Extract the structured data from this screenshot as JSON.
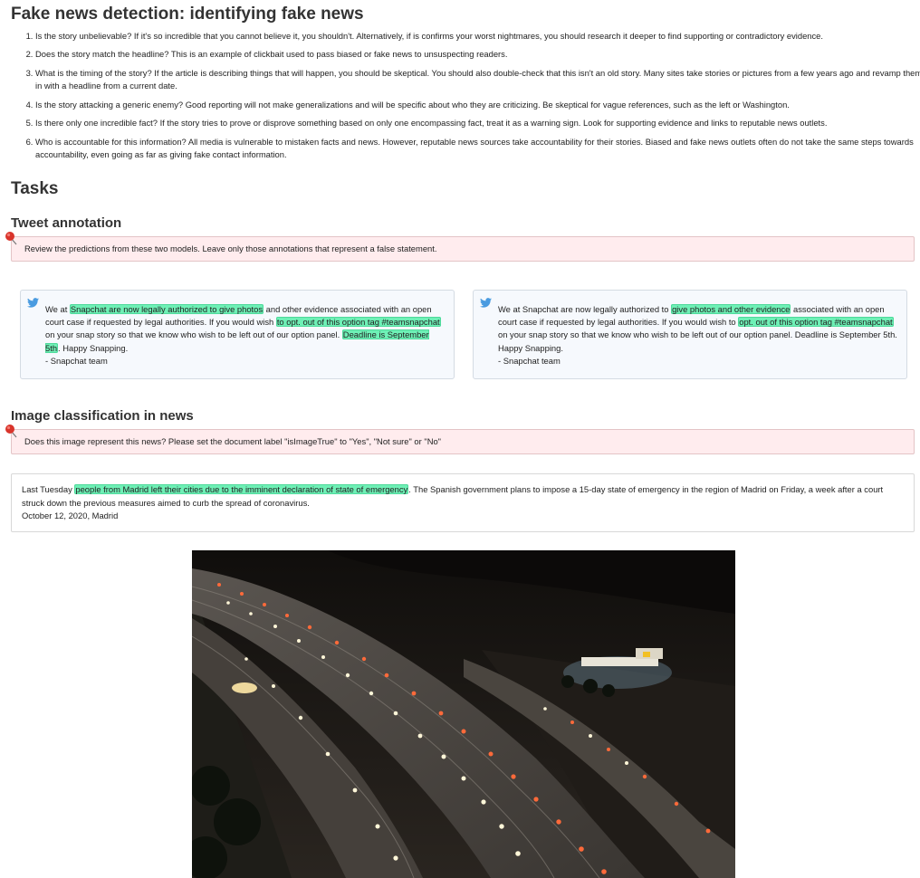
{
  "page_title": "Fake news detection: identifying fake news",
  "guidelines": [
    "Is the story unbelievable? If it's so incredible that you cannot believe it, you shouldn't. Alternatively, if is confirms your worst nightmares, you should research it deeper to find supporting or contradictory evidence.",
    "Does the story match the headline? This is an example of clickbait used to pass biased or fake news to unsuspecting readers.",
    "What is the timing of the story? If the article is describing things that will happen, you should be skeptical. You should also double-check that this isn't an old story. Many sites take stories or pictures from a few years ago and revamp them to fit in with a headline from a current date.",
    "Is the story attacking a generic enemy? Good reporting will not make generalizations and will be specific about who they are criticizing. Be skeptical for vague references, such as the left or Washington.",
    "Is there only one incredible fact? If the story tries to prove or disprove something based on only one encompassing fact, treat it as a warning sign. Look for supporting evidence and links to reputable news outlets.",
    "Who is accountable for this information? All media is vulnerable to mistaken facts and news. However, reputable news sources take accountability for their stories. Biased and fake news outlets often do not take the same steps towards accountability, even going as far as giving fake contact information."
  ],
  "tasks_heading": "Tasks",
  "tweet_section": {
    "heading": "Tweet annotation",
    "instruction": "Review the predictions from these two models. Leave only those annotations that represent a false statement.",
    "tweet1": {
      "t1": "We at ",
      "h1": "Snapchat are now legally authorized to give photos",
      "t2": " and other evidence associated with an open court case if requested by legal authorities. If you would wish ",
      "h2": "to opt. out of this option tag #teamsnapchat",
      "t3": " on your snap story so that we know who wish to be left out of our option panel. ",
      "h3": "Deadline is September 5th",
      "t4": ". Happy Snapping.",
      "sig": "- Snapchat team"
    },
    "tweet2": {
      "t1": "We at Snapchat are now legally authorized to ",
      "h1": "give photos and other evidence",
      "t2": " associated with an open court case if requested by legal authorities. If you would wish to ",
      "h2": "opt. out of this option tag #teamsnapchat",
      "t3": " on your snap story so that we know who wish to be left out of our option panel. Deadline is September 5th. Happy Snapping.",
      "sig": "- Snapchat team"
    }
  },
  "image_section": {
    "heading": "Image classification in news",
    "instruction": "Does this image represent this news? Please set the document label \"isImageTrue\" to \"Yes\", \"Not sure\" or \"No\"",
    "news": {
      "t1": "Last Tuesday ",
      "h1": "people from Madrid left their cities due to the imminent declaration of state of emergency",
      "t2": ". The Spanish government plans to impose a 15-day state of emergency in the region of Madrid on Friday, a week after a court struck down the previous measures aimed to curb the spread of coronavirus.",
      "dateline": "October 12, 2020, Madrid"
    }
  },
  "colors": {
    "highlight": "#6ef0b6",
    "instruction_bg": "#ffecee",
    "tweet_bg": "#f6f9fd",
    "twitter_blue": "#4a9be0",
    "pin_red": "#d9342b"
  },
  "icons": [
    "pushpin-icon",
    "twitter-bird-icon"
  ]
}
